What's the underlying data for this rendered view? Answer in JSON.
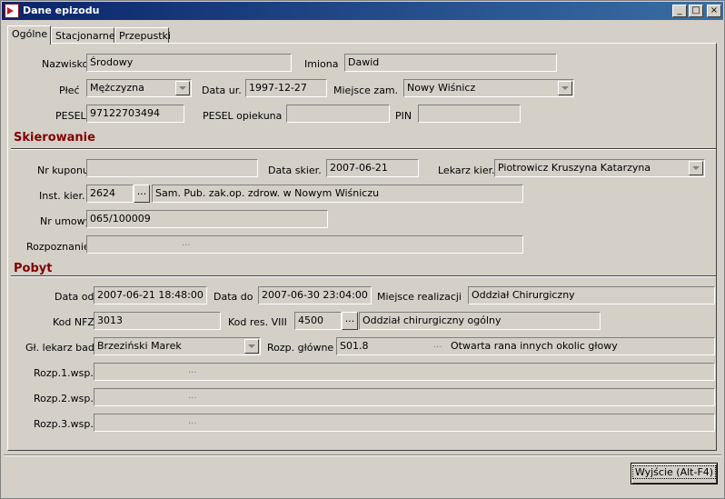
{
  "window": {
    "title": "Dane epizodu",
    "controls": [
      "_",
      "□",
      "×"
    ]
  },
  "tabs": [
    "Ogólne",
    "Stacjonarne",
    "Przepustki"
  ],
  "patient": {
    "nazwisko_label": "Nazwisko",
    "nazwisko": "Środowy",
    "imiona_label": "Imiona",
    "imiona": "Dawid",
    "plec_label": "Płeć",
    "plec": "Mężczyzna",
    "data_ur_label": "Data ur.",
    "data_ur": "1997-12-27",
    "miejsce_zam_label": "Miejsce zam.",
    "miejsce_zam": "Nowy Wiśnicz",
    "pesel_label": "PESEL",
    "pesel": "97122703494",
    "pesel_opiekuna_label": "PESEL opiekuna",
    "pesel_opiekuna": "",
    "pin_label": "PIN",
    "pin": ""
  },
  "skierowanie": {
    "title": "Skierowanie",
    "nr_kuponu_label": "Nr kuponu",
    "nr_kuponu": "",
    "data_skier_label": "Data skier.",
    "data_skier": "2007-06-21",
    "lekarz_kier_label": "Lekarz kier.",
    "lekarz_kier": "Piotrowicz Kruszyna Katarzyna",
    "inst_kier_label": "Inst. kier.",
    "inst_kier_code": "2624",
    "inst_kier_name": "Sam. Pub. zak.op. zdrow.  w Nowym Wiśniczu",
    "nr_umowy_label": "Nr umowy",
    "nr_umowy": "065/100009",
    "rozpoznanie_label": "Rozpoznanie",
    "rozpoznanie": ""
  },
  "pobyt": {
    "title": "Pobyt",
    "data_od_label": "Data od",
    "data_od": "2007-06-21 18:48:00",
    "data_do_label": "Data do",
    "data_do": "2007-06-30 23:04:00",
    "miejsce_realizacji_label": "Miejsce realizacji",
    "miejsce_realizacji": "Oddział Chirurgiczny",
    "kod_nfz_label": "Kod NFZ",
    "kod_nfz": "3013",
    "kod_res_label": "Kod res. VIII",
    "kod_res_code": "4500",
    "kod_res_name": "Oddział chirurgiczny ogólny",
    "gl_lekarz_label": "Gł. lekarz bad.",
    "gl_lekarz": "Brzeziński Marek",
    "rozp_glowne_label": "Rozp. główne",
    "rozp_glowne_code": "S01.8",
    "rozp_glowne_name": "Otwarta rana innych okolic głowy",
    "rozp1_label": "Rozp.1.wsp.",
    "rozp2_label": "Rozp.2.wsp.",
    "rozp3_label": "Rozp.3.wsp."
  },
  "ellipsis": "...",
  "exit_button": "Wyjście (Alt-F4)"
}
